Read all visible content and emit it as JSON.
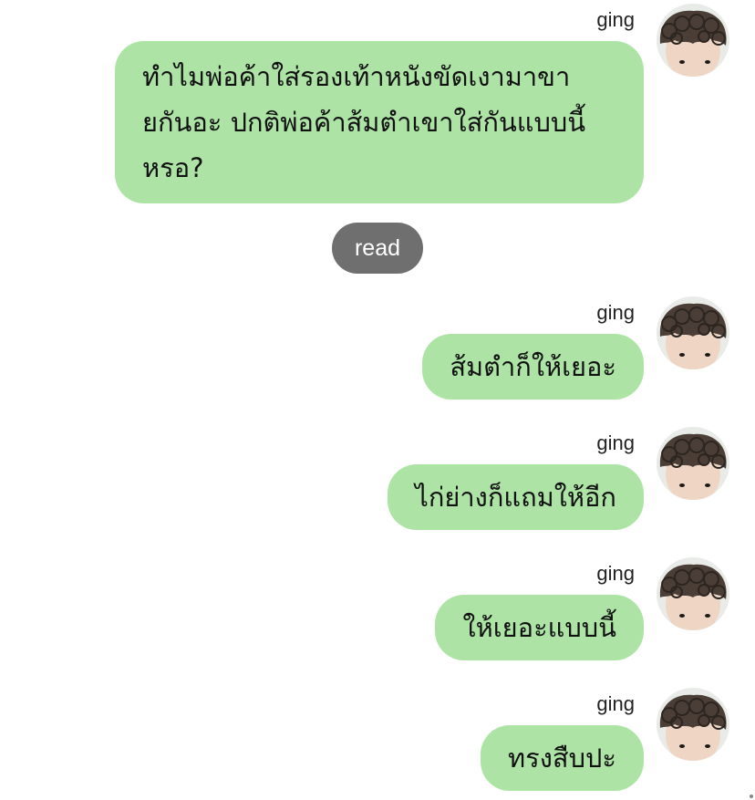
{
  "messages": [
    {
      "sender": "ging",
      "text": "ทำไมพ่อค้าใส่รองเท้าหนังขัดเงามาขายกันอะ ปกติพ่อค้าส้มตำเขาใส่กันแบบนี้หรอ?"
    },
    {
      "sender": "ging",
      "text": "ส้มตำก็ให้เยอะ"
    },
    {
      "sender": "ging",
      "text": "ไก่ย่างก็แถมให้อีก"
    },
    {
      "sender": "ging",
      "text": "ให้เยอะแบบนี้"
    },
    {
      "sender": "ging",
      "text": "ทรงสืบปะ"
    }
  ],
  "read_status": "read",
  "colors": {
    "bubble": "#ade4a6",
    "read_pill": "#6f6f6f",
    "background": "#ffffff"
  },
  "icons": {
    "avatar": "curly-hair-avatar-icon"
  }
}
